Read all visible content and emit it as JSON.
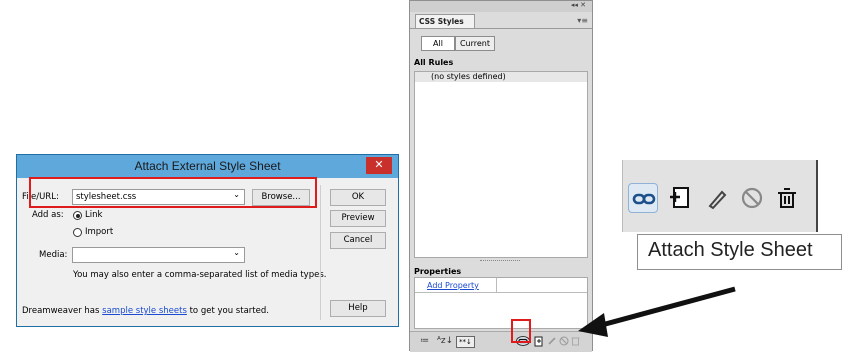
{
  "dialog": {
    "title": "Attach External Style Sheet",
    "close_symbol": "✕",
    "file_url_label": "File/URL:",
    "file_url_value": "stylesheet.css",
    "browse_label": "Browse...",
    "add_as_label": "Add as:",
    "add_as_options": [
      "Link",
      "Import"
    ],
    "add_as_selected": "Link",
    "media_label": "Media:",
    "media_value": "",
    "media_hint": "You may also enter a comma-separated list of media types.",
    "footer_prefix": "Dreamweaver has ",
    "footer_link": "sample style sheets",
    "footer_suffix": " to get you started.",
    "ok_label": "OK",
    "preview_label": "Preview",
    "cancel_label": "Cancel",
    "help_label": "Help"
  },
  "panel": {
    "collapse_glyphs": "◂◂  ✕",
    "tab_label": "CSS Styles",
    "menu_glyph": "▾≡",
    "mode_all": "All",
    "mode_current": "Current",
    "all_rules_heading": "All Rules",
    "rules_placeholder": "(no styles defined)",
    "properties_heading": "Properties",
    "add_property_link": "Add Property",
    "bottom_view_1": "≔",
    "bottom_view_2": "ᴬz↓",
    "bottom_view_3": "**↓"
  },
  "callout": {
    "tooltip_text": "Attach Style Sheet",
    "icons": [
      "link-icon",
      "new-rule-icon",
      "edit-icon",
      "disable-icon",
      "trash-icon"
    ]
  },
  "colors": {
    "dialog_title_bg": "#5fa8dc",
    "close_bg": "#c9302c",
    "highlight_red": "#e01b1b",
    "link_blue": "#1a4bd1"
  }
}
